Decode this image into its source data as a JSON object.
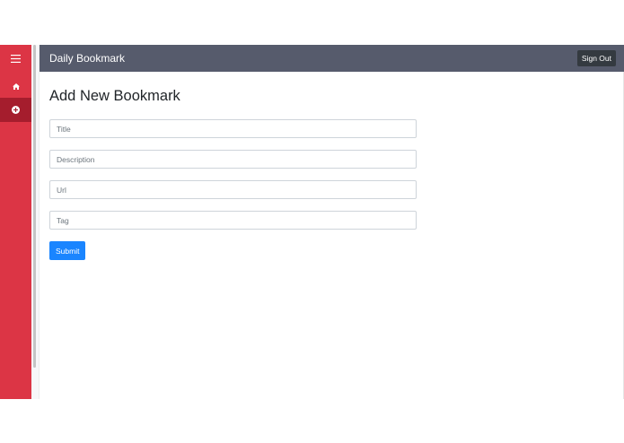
{
  "app": {
    "title": "Daily Bookmark",
    "accent_color": "#dc3545",
    "topbar_color": "#565b6c"
  },
  "sidebar": {
    "items": [
      {
        "icon": "hamburger-menu-icon",
        "active": false
      },
      {
        "icon": "home-icon",
        "active": false
      },
      {
        "icon": "plus-circle-icon",
        "active": true
      }
    ]
  },
  "header": {
    "signout_label": "Sign Out"
  },
  "form": {
    "heading": "Add New Bookmark",
    "fields": [
      {
        "placeholder": "Title",
        "value": ""
      },
      {
        "placeholder": "Description",
        "value": ""
      },
      {
        "placeholder": "Url",
        "value": ""
      },
      {
        "placeholder": "Tag",
        "value": ""
      }
    ],
    "submit_label": "Submit",
    "submit_color": "#1a85ff"
  }
}
